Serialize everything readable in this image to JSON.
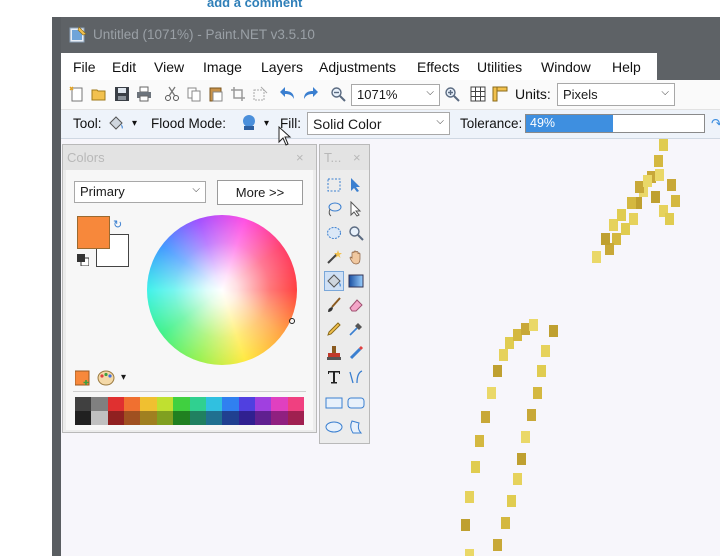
{
  "top_link": "add a comment",
  "window": {
    "title": "Untitled (1071%) - Paint.NET v3.5.10"
  },
  "menu": [
    "File",
    "Edit",
    "View",
    "Image",
    "Layers",
    "Adjustments",
    "Effects",
    "Utilities",
    "Window",
    "Help"
  ],
  "toolbar": {
    "zoom_value": "1071%",
    "units_label": "Units:",
    "units_value": "Pixels"
  },
  "tool_options": {
    "tool_label": "Tool:",
    "flood_mode_label": "Flood Mode:",
    "fill_label": "Fill:",
    "fill_value": "Solid Color",
    "tolerance_label": "Tolerance:",
    "tolerance_text": "49%",
    "tolerance_value": 0.49
  },
  "colors_window": {
    "title": "Colors",
    "close": "×",
    "mode": "Primary",
    "more_button": "More >>",
    "primary_color": "#f7883b",
    "secondary_color": "#ffffff"
  },
  "tools_window": {
    "title": "T...",
    "close": "×"
  },
  "colors": {
    "accent": "#3e8fe0",
    "titlebar": "#5e6266",
    "stroke": "#d8c24a"
  }
}
